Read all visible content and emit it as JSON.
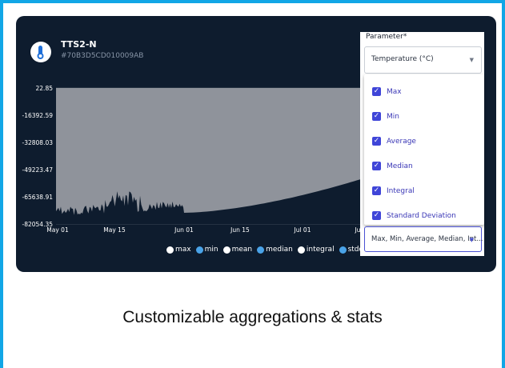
{
  "device": {
    "name": "TTS2-N",
    "id": "#70B3D5CD010009AB"
  },
  "chart_data": {
    "type": "area",
    "y_ticks": [
      "22.85",
      "-16392.59",
      "-32808.03",
      "-49223.47",
      "-65638.91",
      "-82054.35"
    ],
    "x_ticks": [
      "May 01",
      "May 15",
      "Jun 01",
      "Jun 15",
      "Jul 01",
      "Jul"
    ],
    "ylim": [
      -82054.35,
      22.85
    ],
    "grid": true
  },
  "legend": [
    {
      "label": "max",
      "color": "#ffffff"
    },
    {
      "label": "min",
      "color": "#4aa3e8"
    },
    {
      "label": "mean",
      "color": "#ffffff"
    },
    {
      "label": "median",
      "color": "#4aa3e8"
    },
    {
      "label": "integral",
      "color": "#ffffff"
    },
    {
      "label": "stddev",
      "color": "#4aa3e8"
    }
  ],
  "parameter": {
    "label": "Parameter*",
    "selected": "Temperature (°C)",
    "options": [
      {
        "label": "Max",
        "checked": true
      },
      {
        "label": "Min",
        "checked": true
      },
      {
        "label": "Average",
        "checked": true
      },
      {
        "label": "Median",
        "checked": true
      },
      {
        "label": "Integral",
        "checked": true
      },
      {
        "label": "Standard Deviation",
        "checked": true
      }
    ],
    "aggregations_value": "Max, Min, Average, Median, Int..."
  },
  "caption": "Customizable aggregations & stats",
  "colors": {
    "frame": "#11a6e6",
    "panel": "#0e1c2e",
    "plot": "#8f939b",
    "checkbox": "#3f45d8"
  }
}
